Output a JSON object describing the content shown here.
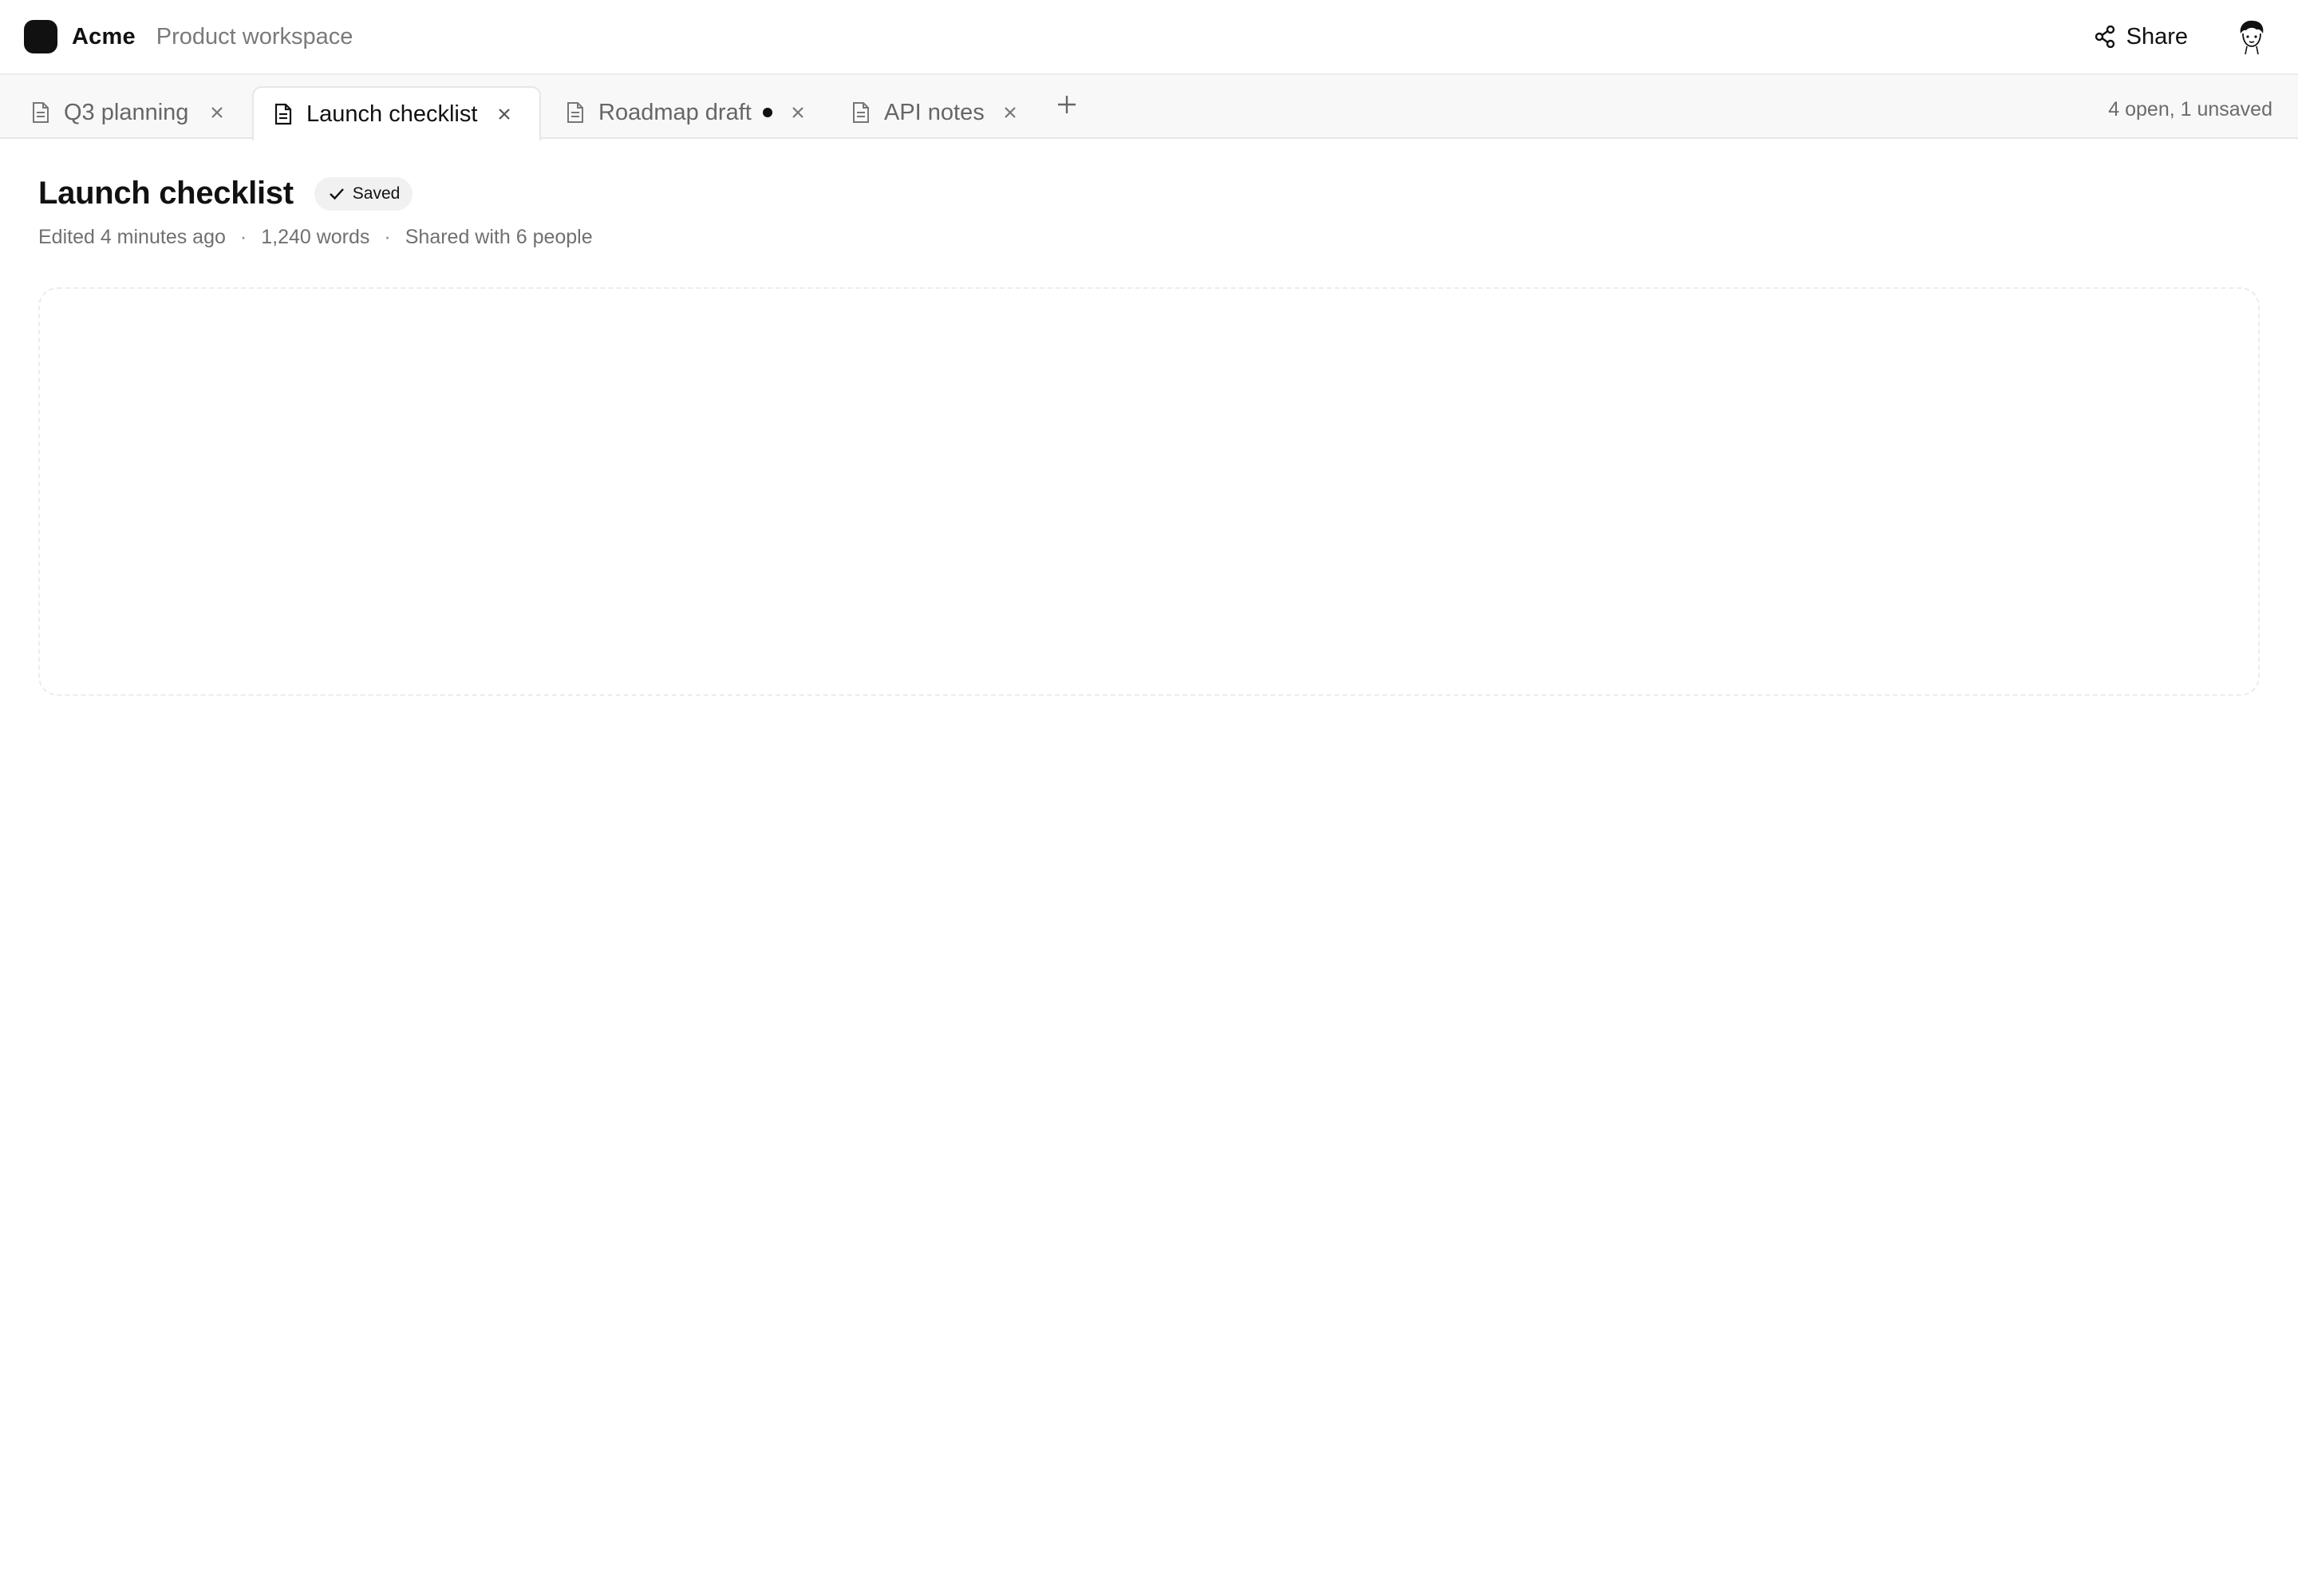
{
  "header": {
    "brand_name": "Acme",
    "workspace_name": "Product workspace",
    "share_label": "Share",
    "icons": {
      "logo": "acme-logo-icon",
      "share": "share-icon",
      "avatar": "user-avatar-icon"
    }
  },
  "tabs": {
    "items": [
      {
        "label": "Q3 planning",
        "active": false,
        "unsaved": false
      },
      {
        "label": "Launch checklist",
        "active": true,
        "unsaved": false
      },
      {
        "label": "Roadmap draft",
        "active": false,
        "unsaved": true
      },
      {
        "label": "API notes",
        "active": false,
        "unsaved": false
      }
    ],
    "status_text": "4 open, 1 unsaved",
    "icons": {
      "file": "document-icon",
      "close": "close-icon",
      "new_tab": "plus-icon"
    }
  },
  "document": {
    "title": "Launch checklist",
    "save_status": "Saved",
    "meta": {
      "edited": "Edited 4 minutes ago",
      "separator": "·",
      "word_count": "1,240 words",
      "shared": "Shared with 6 people"
    }
  },
  "colors": {
    "text_primary": "#111111",
    "text_secondary": "#707070",
    "tab_bar_bg": "#f8f8f8",
    "border": "#e6e6e6",
    "badge_bg": "#f1f1f1"
  }
}
